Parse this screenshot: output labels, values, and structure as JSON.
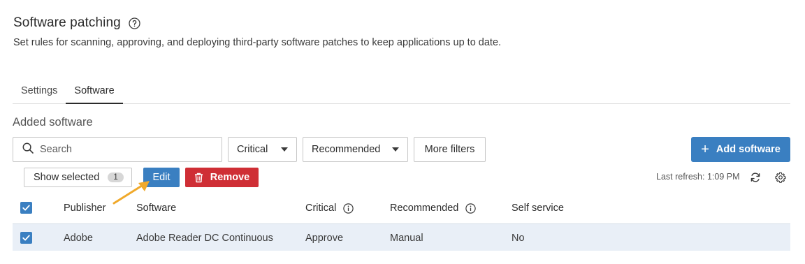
{
  "page": {
    "title": "Software patching",
    "subtitle": "Set rules for scanning, approving, and deploying third-party software patches to keep applications up to date."
  },
  "tabs": [
    {
      "label": "Settings",
      "active": false
    },
    {
      "label": "Software",
      "active": true
    }
  ],
  "section": {
    "title": "Added software"
  },
  "toolbar": {
    "search_placeholder": "Search",
    "critical_filter": "Critical",
    "recommended_filter": "Recommended",
    "more_filters": "More filters",
    "add_software": "Add software",
    "show_selected": "Show selected",
    "selected_count": "1",
    "edit": "Edit",
    "remove": "Remove",
    "last_refresh": "Last refresh: 1:09 PM"
  },
  "table": {
    "columns": [
      "Publisher",
      "Software",
      "Critical",
      "Recommended",
      "Self service"
    ],
    "rows": [
      {
        "selected": true,
        "publisher": "Adobe",
        "software": "Adobe Reader DC Continuous",
        "critical": "Approve",
        "recommended": "Manual",
        "self_service": "No"
      }
    ]
  },
  "colors": {
    "primary": "#3a7fc1",
    "danger": "#cf2e35",
    "selected_row": "#e9eff7",
    "annotation_arrow": "#f0a92b"
  },
  "icons": [
    "help-icon",
    "search-icon",
    "chevron-down-icon",
    "plus-icon",
    "trash-icon",
    "refresh-icon",
    "gear-icon",
    "info-icon",
    "check-icon"
  ]
}
